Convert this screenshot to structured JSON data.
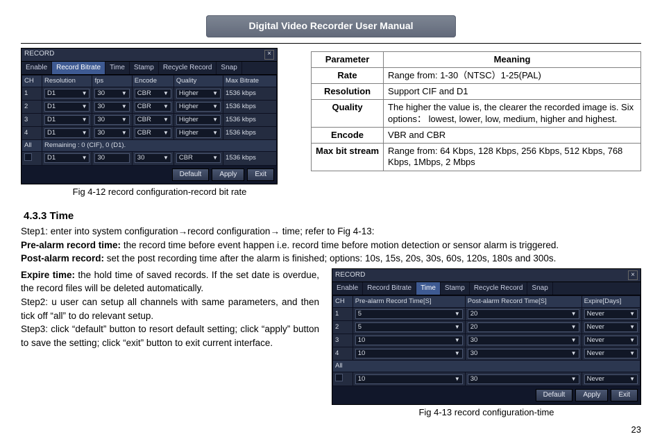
{
  "banner": "Digital Video Recorder User Manual",
  "fig412": {
    "title": "RECORD",
    "tabs": [
      "Enable",
      "Record Bitrate",
      "Time",
      "Stamp",
      "Recycle Record",
      "Snap"
    ],
    "active_tab": 1,
    "headers": [
      "CH",
      "Resolution",
      "fps",
      "Encode",
      "Quality",
      "Max Bitrate"
    ],
    "rows": [
      {
        "ch": "1",
        "res": "D1",
        "fps": "30",
        "enc": "CBR",
        "qual": "Higher",
        "bit": "1536 kbps"
      },
      {
        "ch": "2",
        "res": "D1",
        "fps": "30",
        "enc": "CBR",
        "qual": "Higher",
        "bit": "1536 kbps"
      },
      {
        "ch": "3",
        "res": "D1",
        "fps": "30",
        "enc": "CBR",
        "qual": "Higher",
        "bit": "1536 kbps"
      },
      {
        "ch": "4",
        "res": "D1",
        "fps": "30",
        "enc": "CBR",
        "qual": "Higher",
        "bit": "1536 kbps"
      }
    ],
    "all_label": "All",
    "remaining": "Remaining : 0 (CIF), 0 (D1).",
    "all_row": {
      "res": "D1",
      "fps": "30",
      "fps2": "30",
      "enc": "CBR",
      "bit": "1536 kbps"
    },
    "buttons": {
      "default": "Default",
      "apply": "Apply",
      "exit": "Exit"
    },
    "caption": "Fig 4-12 record configuration-record bit rate"
  },
  "param_table": {
    "head": [
      "Parameter",
      "Meaning"
    ],
    "rows": [
      {
        "p": "Rate",
        "m": "Range from: 1-30（NTSC）1-25(PAL)"
      },
      {
        "p": "Resolution",
        "m": "Support CIF and D1"
      },
      {
        "p": "Quality",
        "m": "The higher the value is, the clearer the recorded image is. Six options： lowest, lower, low, medium, higher and highest."
      },
      {
        "p": "Encode",
        "m": "VBR and CBR"
      },
      {
        "p": "Max bit stream",
        "m": "Range from: 64 Kbps, 128 Kbps, 256 Kbps, 512 Kbps, 768 Kbps, 1Mbps, 2 Mbps"
      }
    ]
  },
  "section": {
    "heading": "4.3.3  Time",
    "step1": "Step1: enter into system configuration→record configuration→ time; refer to Fig 4-13:",
    "prealarm_label": "Pre-alarm record time:",
    "prealarm_text": " the record time before event happen i.e. record time before motion detection or sensor alarm is triggered.",
    "postalarm_label": "Post-alarm record:",
    "postalarm_text": " set the post recording time after the alarm is finished; options: 10s, 15s, 20s, 30s, 60s, 120s, 180s and 300s.",
    "expire_label": "Expire time:",
    "expire_text": " the hold time of saved records. If the set date is overdue, the record files will be deleted automatically.",
    "step2": "Step2: u user can setup all channels with same parameters, and then tick off “all” to do relevant setup.",
    "step3": "Step3: click “default” button to resort default setting; click “apply” button to save the setting; click “exit” button to exit current interface."
  },
  "fig413": {
    "title": "RECORD",
    "tabs": [
      "Enable",
      "Record Bitrate",
      "Time",
      "Stamp",
      "Recycle Record",
      "Snap"
    ],
    "active_tab": 2,
    "headers": [
      "CH",
      "Pre-alarm Record Time[S]",
      "Post-alarm Record Time[S]",
      "Expire[Days]"
    ],
    "rows": [
      {
        "ch": "1",
        "pre": "5",
        "post": "20",
        "exp": "Never"
      },
      {
        "ch": "2",
        "pre": "5",
        "post": "20",
        "exp": "Never"
      },
      {
        "ch": "3",
        "pre": "10",
        "post": "30",
        "exp": "Never"
      },
      {
        "ch": "4",
        "pre": "10",
        "post": "30",
        "exp": "Never"
      }
    ],
    "all_label": "All",
    "all_row": {
      "pre": "10",
      "post": "30",
      "exp": "Never"
    },
    "buttons": {
      "default": "Default",
      "apply": "Apply",
      "exit": "Exit"
    },
    "caption": "Fig 4-13 record configuration-time"
  },
  "page_number": "23"
}
